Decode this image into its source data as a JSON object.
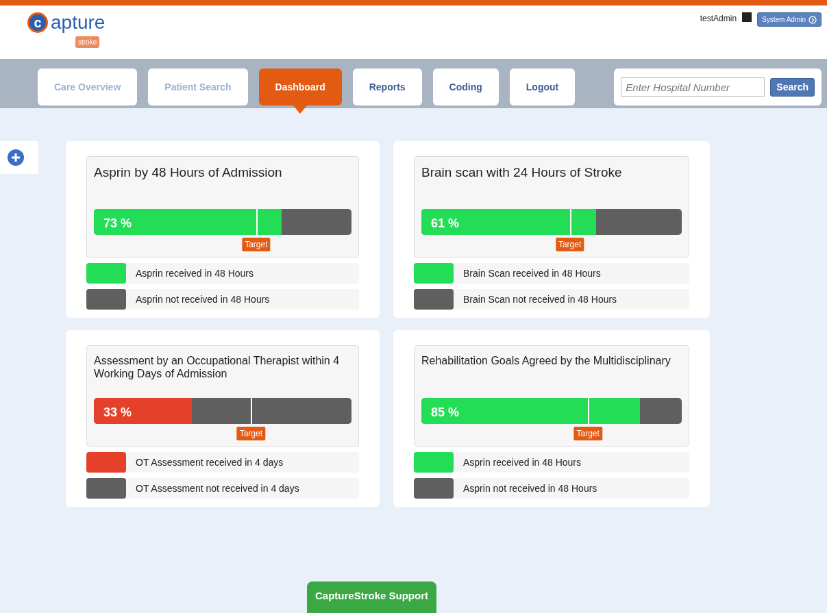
{
  "header": {
    "logo": {
      "word": "apture",
      "initial": "c",
      "sub": "stroke"
    },
    "user": "testAdmin",
    "role_button": "System Admin"
  },
  "nav": {
    "tabs": [
      {
        "label": "Care Overview",
        "selected": false
      },
      {
        "label": "Patient Search",
        "selected": false
      },
      {
        "label": "Dashboard",
        "selected": true
      },
      {
        "label": "Reports",
        "selected": false
      },
      {
        "label": "Coding",
        "selected": false
      },
      {
        "label": "Logout",
        "selected": false
      }
    ],
    "search": {
      "placeholder": "Enter Hospital Number",
      "button": "Search"
    }
  },
  "cards": [
    {
      "title": "Asprin by 48 Hours of Admission",
      "percent": "73 %",
      "level": 0.73,
      "target": {
        "label": "Target",
        "level": 0.63
      },
      "color": "#22dd55",
      "legend": [
        {
          "label": "Asprin received in 48 Hours",
          "color": "#22dd55"
        },
        {
          "label": "Asprin not received in 48 Hours",
          "color": "#5f5f5f"
        }
      ]
    },
    {
      "title": "Brain scan with 24 Hours of Stroke",
      "percent": "61 %",
      "level": 0.67,
      "target": {
        "label": "Target",
        "level": 0.57
      },
      "color": "#22dd55",
      "legend": [
        {
          "label": "Brain Scan received in 48 Hours",
          "color": "#22dd55"
        },
        {
          "label": "Brain Scan not received in 48 Hours",
          "color": "#5f5f5f"
        }
      ]
    },
    {
      "title": "Assessment by an Occupational Therapist within 4 Working Days of Admission",
      "percent": "33 %",
      "level": 0.38,
      "target": {
        "label": "Target",
        "level": 0.61
      },
      "color": "#e5402a",
      "legend": [
        {
          "label": "OT Assessment received in 4 days",
          "color": "#e5402a"
        },
        {
          "label": "OT Assessment not received in 4 days",
          "color": "#5f5f5f"
        }
      ]
    },
    {
      "title": "Rehabilitation Goals Agreed by the Multidisciplinary",
      "percent": "85 %",
      "level": 0.84,
      "target": {
        "label": "Target",
        "level": 0.64
      },
      "color": "#22dd55",
      "legend": [
        {
          "label": "Asprin received in 48 Hours",
          "color": "#22dd55"
        },
        {
          "label": "Asprin not received in 48 Hours",
          "color": "#5f5f5f"
        }
      ]
    }
  ],
  "support": "CaptureStroke Support"
}
